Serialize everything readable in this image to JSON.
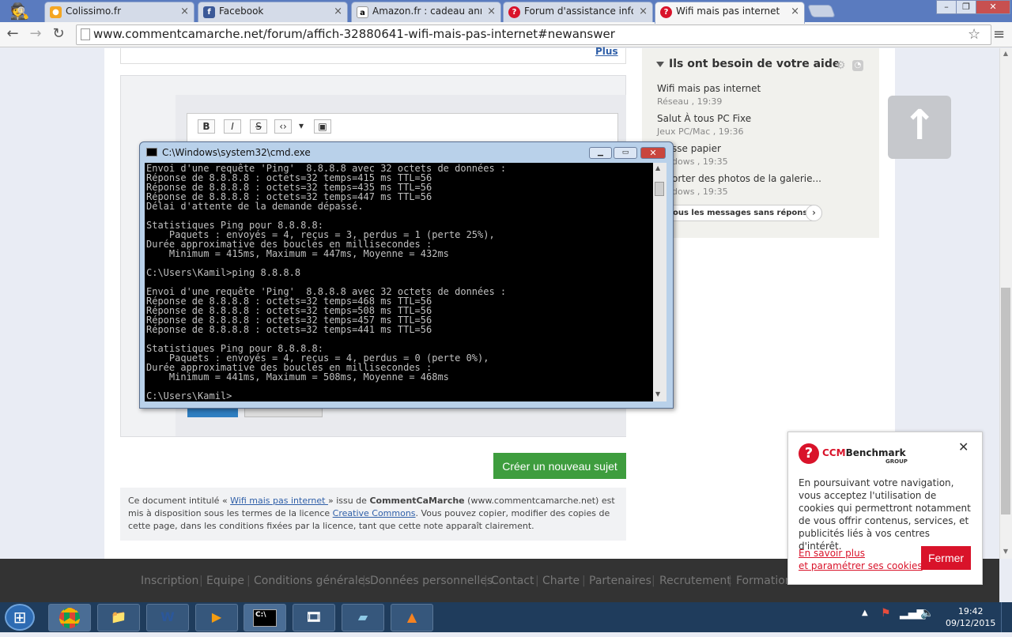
{
  "browser": {
    "tabs": [
      {
        "label": "Colissimo.fr",
        "icon": "colissimo-icon"
      },
      {
        "label": "Facebook",
        "icon": "facebook-icon"
      },
      {
        "label": "Amazon.fr : cadeau annive",
        "icon": "amazon-icon"
      },
      {
        "label": "Forum d'assistance inform",
        "icon": "ccm-icon"
      },
      {
        "label": "Wifi mais pas internet",
        "icon": "ccm-icon"
      }
    ],
    "url": "www.commentcamarche.net/forum/affich-32880641-wifi-mais-pas-internet#newanswer"
  },
  "page": {
    "plus_link": "Plus",
    "sidebar": {
      "title": "Ils ont besoin de votre aide",
      "items": [
        {
          "title": "Wifi mais pas internet",
          "meta": "Réseau , 19:39"
        },
        {
          "title": "Salut À tous PC Fixe",
          "meta": "Jeux PC/Mac , 19:36"
        },
        {
          "title": "sse papier",
          "meta": "dows , 19:35"
        },
        {
          "title": "orter des photos de la galerie...",
          "meta": "dows , 19:35"
        }
      ],
      "all_messages": "ous les messages sans réponse"
    },
    "editor_buttons": [
      "B",
      "I",
      "S",
      "‹›",
      "▾",
      "▣"
    ],
    "new_subject_button": "Créer un nouveau sujet",
    "notice": {
      "part1": "Ce document intitulé « ",
      "link": "Wifi mais pas internet ",
      "part2": " » issu de ",
      "brand": "CommentCaMarche",
      "part3": " (www.commentcamarche.net) est mis à disposition sous les termes de la licence ",
      "license": "Creative Commons",
      "part4": ". Vous pouvez copier, modifier des copies de cette page, dans les conditions fixées par la licence, tant que cette note apparaît clairement."
    },
    "footer_links": [
      "Inscription",
      "Equipe",
      "Conditions générales",
      "Données personnelles",
      "Contact",
      "Charte",
      "Partenaires",
      "Recrutement",
      "Formation"
    ]
  },
  "cmd": {
    "title": "C:\\Windows\\system32\\cmd.exe",
    "lines": [
      "Envoi d'une requête 'Ping'  8.8.8.8 avec 32 octets de données :",
      "Réponse de 8.8.8.8 : octets=32 temps=415 ms TTL=56",
      "Réponse de 8.8.8.8 : octets=32 temps=435 ms TTL=56",
      "Réponse de 8.8.8.8 : octets=32 temps=447 ms TTL=56",
      "Délai d'attente de la demande dépassé.",
      "",
      "Statistiques Ping pour 8.8.8.8:",
      "    Paquets : envoyés = 4, reçus = 3, perdus = 1 (perte 25%),",
      "Durée approximative des boucles en millisecondes :",
      "    Minimum = 415ms, Maximum = 447ms, Moyenne = 432ms",
      "",
      "C:\\Users\\Kamil>ping 8.8.8.8",
      "",
      "Envoi d'une requête 'Ping'  8.8.8.8 avec 32 octets de données :",
      "Réponse de 8.8.8.8 : octets=32 temps=468 ms TTL=56",
      "Réponse de 8.8.8.8 : octets=32 temps=508 ms TTL=56",
      "Réponse de 8.8.8.8 : octets=32 temps=457 ms TTL=56",
      "Réponse de 8.8.8.8 : octets=32 temps=441 ms TTL=56",
      "",
      "Statistiques Ping pour 8.8.8.8:",
      "    Paquets : envoyés = 4, reçus = 4, perdus = 0 (perte 0%),",
      "Durée approximative des boucles en millisecondes :",
      "    Minimum = 441ms, Maximum = 508ms, Moyenne = 468ms",
      "",
      "C:\\Users\\Kamil>"
    ]
  },
  "cookie": {
    "brand": "CCM",
    "brand_rest": "Benchmark",
    "group": "GROUP",
    "text": "En poursuivant votre navigation, vous acceptez l'utilisation de cookies qui permettront notamment de vous offrir contenus, services, et publicités liés à vos centres d'intérêt.",
    "link1": "En savoir plus",
    "link2": "et paramétrer ses cookies",
    "close_button": "Fermer"
  },
  "taskbar": {
    "time": "19:42",
    "date": "09/12/2015"
  },
  "colors": {
    "accent_red": "#d9132a",
    "green_button": "#3e9d3e",
    "link_blue": "#2f5fa8"
  }
}
